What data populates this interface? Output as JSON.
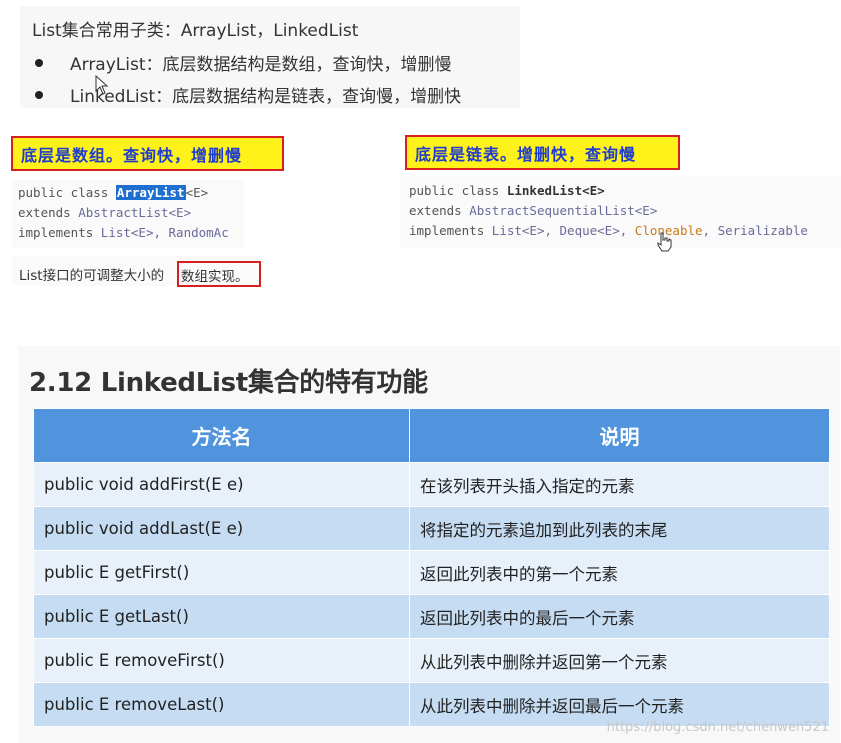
{
  "intro": {
    "title": "List集合常用子类：ArrayList，LinkedList",
    "bullets": [
      "ArrayList：底层数据结构是数组，查询快，增删慢",
      "LinkedList：底层数据结构是链表，查询慢，增删快"
    ]
  },
  "arraylist": {
    "callout": "底层是数组。查询快，增删慢",
    "code": {
      "line1_pre": "public class ",
      "line1_name": "ArrayList",
      "line1_post": "<E>",
      "line2_kw": "extends ",
      "line2_type": "AbstractList<E>",
      "line3_kw": "implements ",
      "line3_type": "List<E>, RandomAc"
    },
    "desc_pre": "List接口的可调整大小的",
    "desc_boxed": "数组实现。"
  },
  "linkedlist": {
    "callout": "底层是链表。增删快，查询慢",
    "code": {
      "line1_pre": "public class ",
      "line1_name": "LinkedList<E>",
      "line2_kw": "extends ",
      "line2_type": "AbstractSequentialList<E>",
      "line3_kw": "implements ",
      "line3_type": "List<E>, Deque<E>, ",
      "line3_orange": "Cloneable",
      "line3_tail": ", Serializable"
    }
  },
  "section": {
    "title": "2.12 LinkedList集合的特有功能"
  },
  "table": {
    "headers": [
      "方法名",
      "说明"
    ],
    "rows": [
      {
        "method": "public void addFirst(E e)",
        "desc": "在该列表开头插入指定的元素"
      },
      {
        "method": "public void addLast(E e)",
        "desc": "将指定的元素追加到此列表的末尾"
      },
      {
        "method": "public E getFirst()",
        "desc": "返回此列表中的第一个元素"
      },
      {
        "method": "public E getLast()",
        "desc": "返回此列表中的最后一个元素"
      },
      {
        "method": "public E removeFirst()",
        "desc": "从此列表中删除并返回第一个元素"
      },
      {
        "method": "public E removeLast()",
        "desc": "从此列表中删除并返回最后一个元素"
      }
    ]
  },
  "watermark": "https://blog.csdn.net/chenwen521",
  "icons": {
    "arrow_cursor": "mouse-pointer-icon",
    "hand_cursor": "hand-pointer-icon"
  }
}
